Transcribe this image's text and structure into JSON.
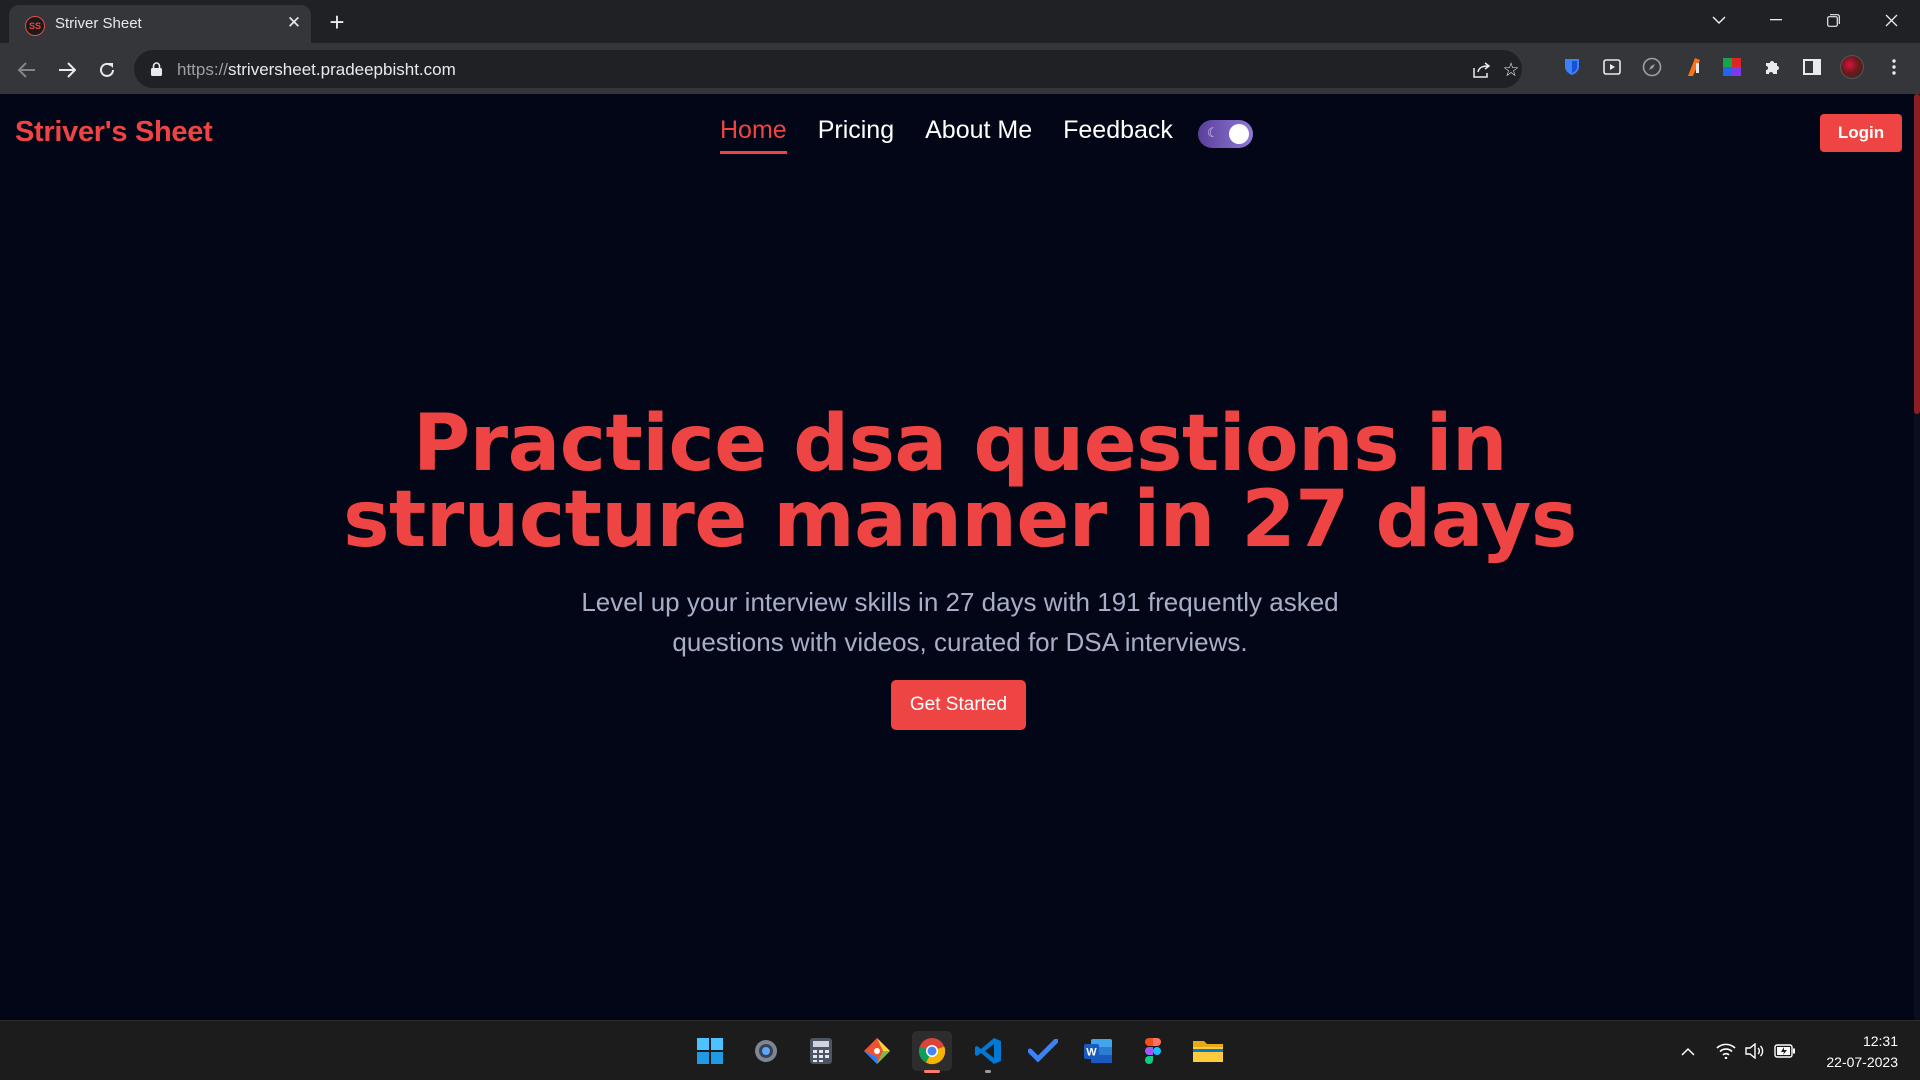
{
  "browser": {
    "tab_title": "Striver Sheet",
    "tab_favicon_text": "SS",
    "url_scheme": "https://",
    "url_host": "striversheet.pradeepbisht.com"
  },
  "site": {
    "brand": "Striver's Sheet",
    "nav": [
      {
        "label": "Home",
        "active": true
      },
      {
        "label": "Pricing",
        "active": false
      },
      {
        "label": "About Me",
        "active": false
      },
      {
        "label": "Feedback",
        "active": false
      }
    ],
    "login_label": "Login",
    "hero": {
      "title_line1": "Practice dsa questions in",
      "title_line2": "structure manner in 27 days",
      "subtitle_line1": "Level up your interview skills in 27 days with 191 frequently asked",
      "subtitle_line2": "questions with videos, curated for DSA interviews.",
      "cta_label": "Get Started"
    },
    "colors": {
      "accent": "#ef4444",
      "background": "#030616",
      "subtitle": "#a6afc7"
    }
  },
  "taskbar": {
    "apps": [
      "windows-start-icon",
      "settings-icon",
      "calculator-icon",
      "git-icon",
      "chrome-icon",
      "vscode-icon",
      "todo-icon",
      "word-icon",
      "figma-icon",
      "file-explorer-icon"
    ],
    "clock_time": "12:31",
    "clock_date": "22-07-2023"
  }
}
